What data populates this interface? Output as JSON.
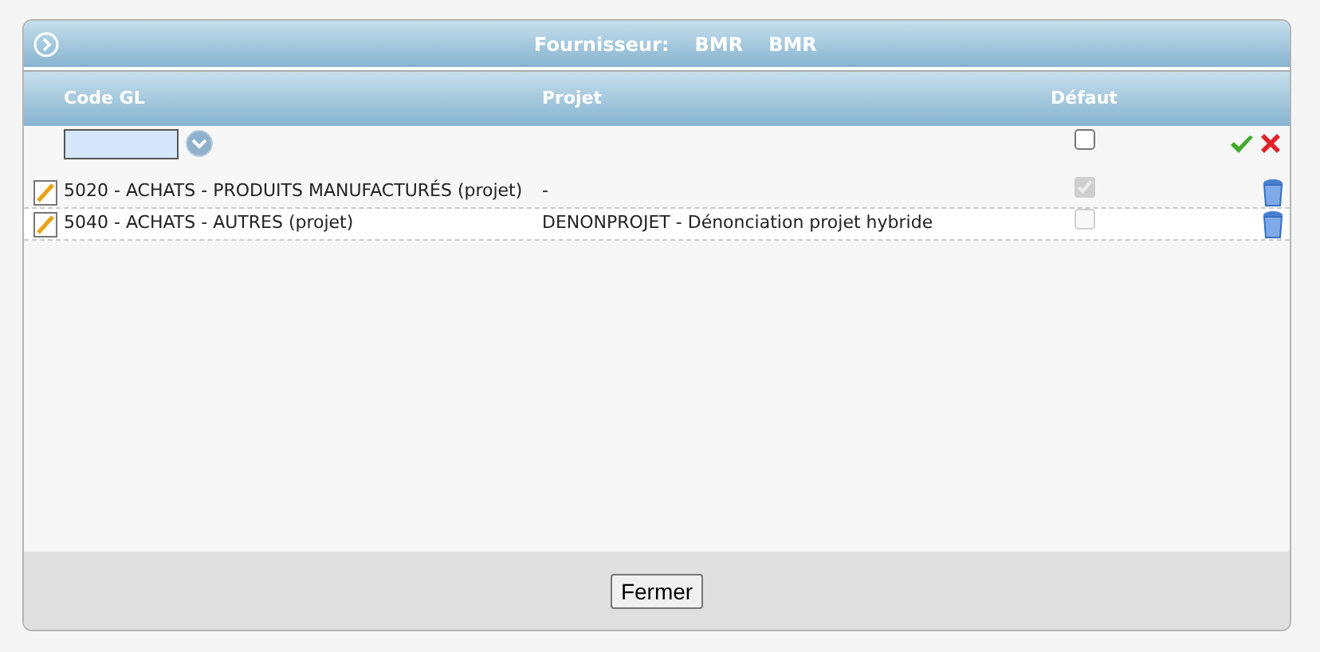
{
  "title": {
    "label": "Fournisseur:",
    "values": [
      "BMR",
      "BMR"
    ]
  },
  "columns": [
    "Code GL",
    "Projet",
    "Défaut"
  ],
  "filter": {
    "default_checked": false
  },
  "rows": [
    {
      "code": "5020 - ACHATS - PRODUITS MANUFACTURÉS (projet)",
      "projet": "-",
      "default": true,
      "disabled": true
    },
    {
      "code": "5040 - ACHATS - AUTRES (projet)",
      "projet": "DENONPROJET - Dénonciation projet hybride",
      "default": false,
      "disabled": true
    }
  ],
  "buttons": [
    "Fermer"
  ]
}
